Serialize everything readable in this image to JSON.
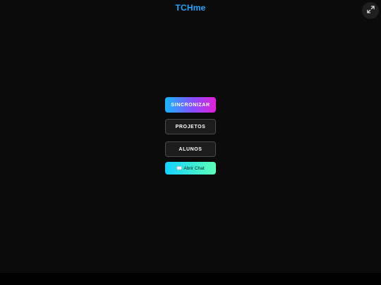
{
  "header": {
    "title": "TCHme"
  },
  "menu": {
    "sync_label": "SINCRONIZAR",
    "projects_label": "PROJETOS",
    "students_label": "ALUNOS",
    "chat_label": "Abrir Chat"
  },
  "icons": {
    "fullscreen": "expand-icon",
    "chat": "chat-bubble-icon"
  },
  "colors": {
    "title": "#1ea7ff",
    "background": "#0b0b0b",
    "sync_gradient_start": "#13b8ff",
    "sync_gradient_end": "#e21fd6",
    "chat_gradient_start": "#12d3ff",
    "chat_gradient_end": "#5cffb8"
  }
}
